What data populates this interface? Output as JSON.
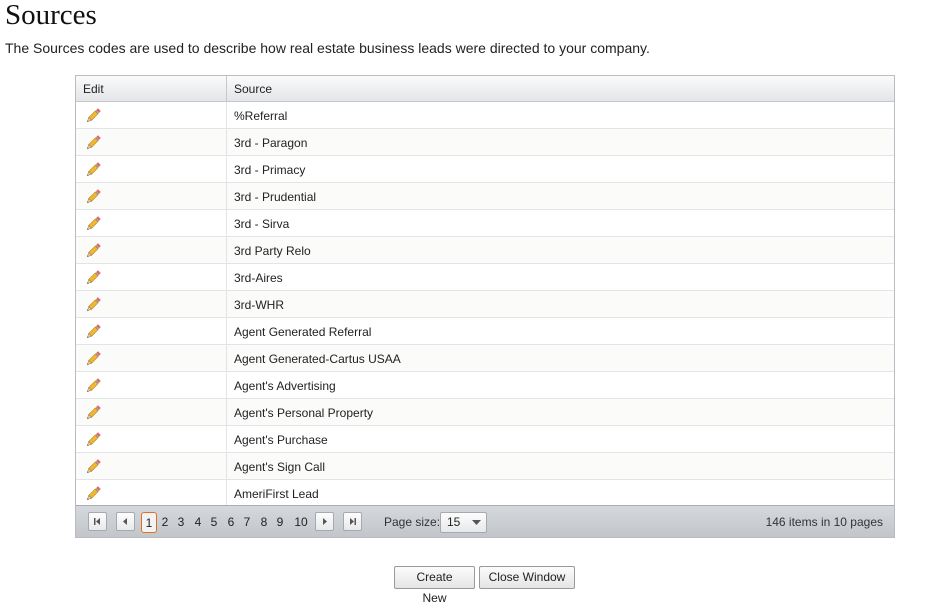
{
  "page": {
    "title": "Sources",
    "description": "The Sources codes are used to describe how real estate business leads were directed to your company."
  },
  "grid": {
    "columns": {
      "edit": "Edit",
      "source": "Source"
    },
    "rows": [
      "%Referral",
      "3rd - Paragon",
      "3rd - Primacy",
      "3rd - Prudential",
      "3rd - Sirva",
      "3rd Party Relo",
      "3rd-Aires",
      "3rd-WHR",
      "Agent Generated Referral",
      "Agent Generated-Cartus USAA",
      "Agent's Advertising",
      "Agent's Personal Property",
      "Agent's Purchase",
      "Agent's Sign Call",
      "AmeriFirst Lead"
    ],
    "edit_icon": "pencil-icon"
  },
  "pager": {
    "pages": [
      "1",
      "2",
      "3",
      "4",
      "5",
      "6",
      "7",
      "8",
      "9",
      "10"
    ],
    "current_page": "1",
    "page_size_label": "Page size:",
    "page_size": "15",
    "info": "146 items in 10 pages"
  },
  "actions": {
    "create_new": "Create New",
    "close_window": "Close Window"
  },
  "colors": {
    "current_page_border": "#e0701f",
    "pager_background": "#c8cbd0",
    "grid_border": "#b9bdc2"
  }
}
